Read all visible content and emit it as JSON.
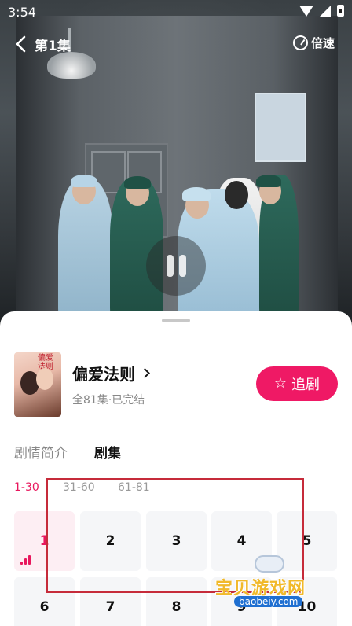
{
  "status_bar": {
    "time": "3:54"
  },
  "player": {
    "episode_title": "第1集",
    "speed_label": "倍速"
  },
  "drama": {
    "title": "偏爱法则",
    "cover_title": "偏爱法则",
    "meta": "全81集·已完结",
    "follow_label": "追剧"
  },
  "tabs": [
    {
      "label": "剧情简介",
      "active": false
    },
    {
      "label": "剧集",
      "active": true
    }
  ],
  "ranges": [
    {
      "label": "1-30",
      "active": true
    },
    {
      "label": "31-60",
      "active": false
    },
    {
      "label": "61-81",
      "active": false
    }
  ],
  "episodes": [
    "1",
    "2",
    "3",
    "4",
    "5",
    "6",
    "7",
    "8",
    "9",
    "10"
  ],
  "current_episode": "1",
  "watermark": {
    "text": "宝贝游戏网",
    "url": "baobeiy.com"
  },
  "colors": {
    "accent": "#ef1965",
    "highlight_box": "#c62b3a"
  }
}
